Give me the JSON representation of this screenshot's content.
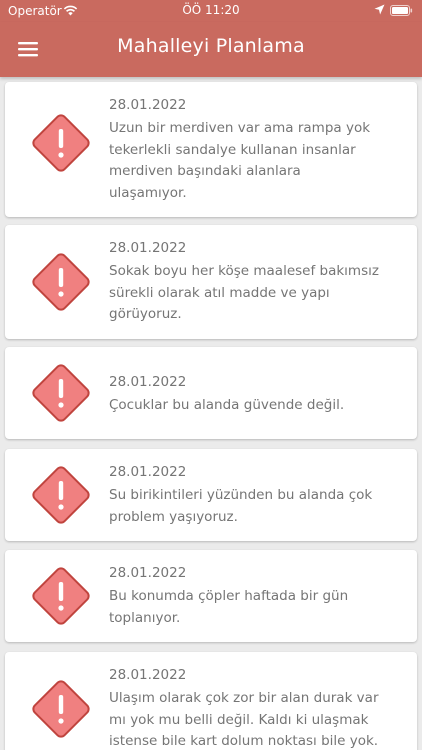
{
  "status_bar": {
    "carrier": "Operatör",
    "time": "ÖÖ 11:20",
    "wifi_icon": "wifi-icon",
    "location_icon": "location-arrow-icon",
    "battery_icon": "battery-icon"
  },
  "app_bar": {
    "title": "Mahalleyi Planlama",
    "menu_icon": "hamburger-menu-icon"
  },
  "colors": {
    "primary": "#c96a5f",
    "warning_fill": "#f08080",
    "warning_stroke": "#c0443e",
    "text": "#757575",
    "background": "#ebebeb"
  },
  "reports": [
    {
      "icon": "warning-icon",
      "date": "28.01.2022",
      "lines": [
        "Uzun bir merdiven var ama rampa yok",
        "tekerlekli sandalye kullanan insanlar",
        "merdiven başındaki alanlara",
        "ulaşamıyor."
      ]
    },
    {
      "icon": "warning-icon",
      "date": "28.01.2022",
      "lines": [
        "Sokak boyu her köşe maalesef bakımsız",
        "sürekli olarak atıl madde ve yapı",
        "görüyoruz."
      ]
    },
    {
      "icon": "warning-icon",
      "date": "28.01.2022",
      "lines": [
        "Çocuklar bu alanda güvende değil."
      ]
    },
    {
      "icon": "warning-icon",
      "date": "28.01.2022",
      "lines": [
        "Su birikintileri yüzünden bu alanda çok",
        "problem yaşıyoruz."
      ]
    },
    {
      "icon": "warning-icon",
      "date": "28.01.2022",
      "lines": [
        "Bu konumda çöpler haftada bir gün",
        "toplanıyor."
      ]
    },
    {
      "icon": "warning-icon",
      "date": "28.01.2022",
      "lines": [
        "Ulaşım olarak çok zor bir alan durak var",
        "mı yok mu belli değil. Kaldı ki ulaşmak",
        "istense bile kart dolum noktası bile yok."
      ]
    }
  ]
}
